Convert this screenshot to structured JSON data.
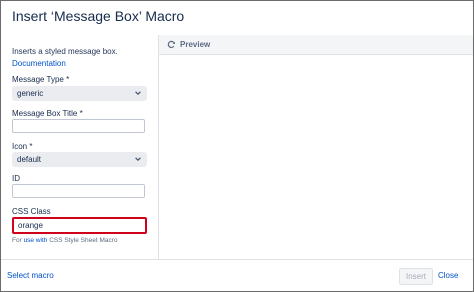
{
  "dialog": {
    "title": "Insert ‘Message Box’ Macro"
  },
  "form": {
    "description": "Inserts a styled message box.",
    "documentation_link": "Documentation",
    "message_type": {
      "label": "Message Type *",
      "value": "generic"
    },
    "message_box_title": {
      "label": "Message Box Title *",
      "value": ""
    },
    "icon": {
      "label": "Icon *",
      "value": "default"
    },
    "id": {
      "label": "ID",
      "value": ""
    },
    "css_class": {
      "label": "CSS Class",
      "value": "orange"
    },
    "hint": {
      "prefix": "For ",
      "link": "use with",
      "suffix": " CSS Style Sheet Macro"
    }
  },
  "preview": {
    "label": "Preview"
  },
  "footer": {
    "select_macro": "Select macro",
    "insert": "Insert",
    "close": "Close"
  },
  "colors": {
    "link": "#0052cc",
    "highlight_border": "#d0021b",
    "select_bg": "#ebecf0"
  }
}
